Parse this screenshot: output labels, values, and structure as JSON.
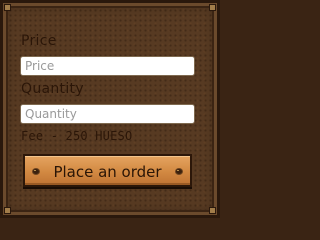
{
  "order_form": {
    "price_label": "Price",
    "price_placeholder": "Price",
    "quantity_label": "Quantity",
    "quantity_placeholder": "Quantity",
    "fee_text": "Fee - 250 HUESO",
    "submit_label": "Place an order"
  },
  "colors": {
    "panel": "#573a22",
    "button": "#d28942",
    "text": "#2b1608"
  }
}
